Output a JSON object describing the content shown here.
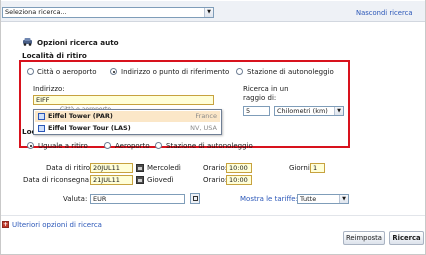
{
  "header": {
    "search_select": "Seleziona ricerca...",
    "hide_link": "Nascondi ricerca"
  },
  "options": {
    "title": "Opzioni ricerca auto",
    "pickup_title": "Località di ritiro",
    "radio_city": "Città o aeroporto",
    "radio_address": "Indirizzo o punto di riferimento",
    "radio_station": "Stazione di autonoleggio"
  },
  "address": {
    "label": "Indirizzo:",
    "value": "EIFF",
    "hint_partial": "Città o aeroporto",
    "radius_label": "Ricerca in un raggio di:",
    "radius_value": "5",
    "radius_unit": "Chilometri (km)"
  },
  "suggestions": [
    {
      "name": "Eiffel Tower (PAR)",
      "country": "France"
    },
    {
      "name": "Eiffel Tower Tour (LAS)",
      "country": "NV, USA"
    }
  ],
  "return": {
    "title_partial": "Loca",
    "radio_same": "Uguale a ritiro",
    "radio_airport": "Aeroporto",
    "radio_station": "Stazione di autonoleggio"
  },
  "dates": {
    "pickup_label": "Data di ritiro:",
    "pickup_value": "20JUL11",
    "pickup_day": "Mercoledì",
    "return_label": "Data di riconsegna:",
    "return_value": "21JUL11",
    "return_day": "Giovedì",
    "time_label": "Orario:",
    "pickup_time": "10:00",
    "return_time": "10:00",
    "days_label": "Giorni:",
    "days_value": "1"
  },
  "currency": {
    "label": "Valuta:",
    "value": "EUR",
    "show_rates_label": "Mostra le tariffe:",
    "show_rates_value": "Tutte"
  },
  "footer": {
    "more_options": "Ulteriori opzioni di ricerca",
    "reset_button": "Reimposta",
    "search_button": "Ricerca"
  },
  "colors": {
    "highlight_border": "#d8121d",
    "link": "#2b57b8",
    "selected_suggestion": "#fbe7c8"
  }
}
